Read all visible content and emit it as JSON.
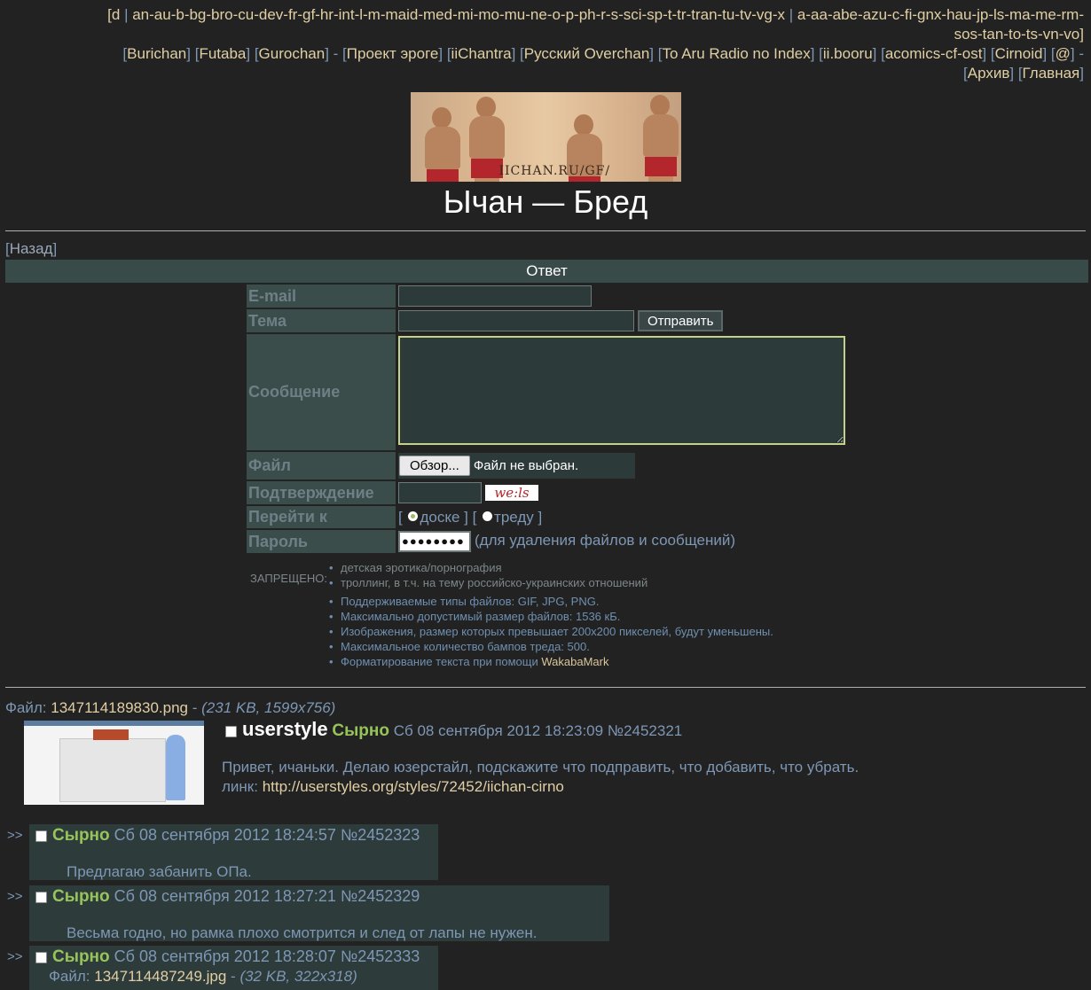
{
  "nav": {
    "line1_part1": "an-au-b-bg-bro-cu-dev-fr-gf-hr-int-l-m-maid-med-mi-mo-mu-ne-o-p-ph-r-s-sci-sp-t-tr-tran-tu-tv-vg-x",
    "line1_prefix": "[d",
    "line1_part2": "a-aa-abe-azu-c-fi-gnx-hau-jp-ls-ma-me-rm-",
    "line2": "sos-tan-to-ts-vn-vo]",
    "links": [
      "Burichan",
      "Futaba",
      "Gurochan",
      "Проект эроге",
      "iiChantra",
      "Русский Overchan",
      "To Aru Radio no Index",
      "ii.booru",
      "acomics-cf-ost",
      "Cirnoid",
      "@"
    ],
    "archive": "Архив",
    "home": "Главная"
  },
  "banner": {
    "caption": "IICHAN.RU/GF/"
  },
  "board_title": "Ычан — Бред",
  "back": {
    "label": "Назад"
  },
  "reply_bar": "Ответ",
  "form": {
    "email_label": "E-mail",
    "subject_label": "Тема",
    "submit_label": "Отправить",
    "message_label": "Сообщение",
    "file_label": "Файл",
    "browse_label": "Обзор...",
    "file_status": "Файл не выбран.",
    "confirm_label": "Подтверждение",
    "captcha_text": "we:ls",
    "goto_label": "Перейти к",
    "goto_board": "доске",
    "goto_thread": "треду",
    "password_label": "Пароль",
    "password_value": "●●●●●●●●",
    "password_note": "(для удаления файлов и сообщений)"
  },
  "rules": {
    "forbidden_label": "ЗАПРЕЩЕНО:",
    "forbidden": [
      "детская эротика/порнография",
      "троллинг, в т.ч. на тему российско-украинских отношений"
    ],
    "info": [
      "Поддерживаемые типы файлов: GIF, JPG, PNG.",
      "Максимально допустимый размер файлов: 1536 кБ.",
      "Изображения, размер которых превышает 200x200 пикселей, будут уменьшены.",
      "Максимальное количество бампов треда: 500."
    ],
    "markup_prefix": "Форматирование текста при помощи ",
    "markup_link": "WakabaMark"
  },
  "op": {
    "file_prefix": "Файл:",
    "file_name": "1347114189830.png",
    "file_meta": "(231 KB, 1599x756)",
    "subject": "userstyle",
    "name": "Сырно",
    "date": "Сб 08 сентября 2012 18:23:09",
    "number": "№2452321",
    "body_line1": "Привет, ичаньки. Делаю юзерстайл, подскажите что подправить, что добавить, что убрать.",
    "body_link_label": "линк:",
    "body_link": "http://userstyles.org/styles/72452/iichan-cirno"
  },
  "replies": [
    {
      "arrow": ">>",
      "name": "Сырно",
      "date": "Сб 08 сентября 2012 18:24:57",
      "number": "№2452323",
      "body": "Предлагаю забанить ОПа."
    },
    {
      "arrow": ">>",
      "name": "Сырно",
      "date": "Сб 08 сентября 2012 18:27:21",
      "number": "№2452329",
      "body": "Весьма годно, но рамка плохо смотрится и след от лапы не нужен."
    },
    {
      "arrow": ">>",
      "name": "Сырно",
      "date": "Сб 08 сентября 2012 18:28:07",
      "number": "№2452333",
      "file_prefix": "Файл:",
      "file_name": "1347114487249.jpg",
      "file_meta": "(32 KB, 322x318)"
    }
  ]
}
